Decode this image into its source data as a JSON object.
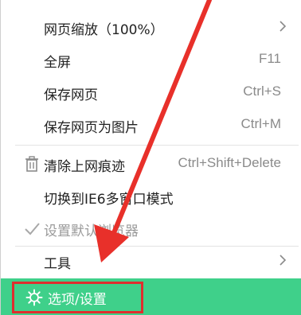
{
  "menu": {
    "items": [
      {
        "label": "网页缩放（100%）",
        "shortcut": "",
        "submenu": true
      },
      {
        "label": "全屏",
        "shortcut": "F11"
      },
      {
        "label": "保存网页",
        "shortcut": "Ctrl+S"
      },
      {
        "label": "保存网页为图片",
        "shortcut": "Ctrl+M"
      },
      {
        "label": "清除上网痕迹",
        "shortcut": "Ctrl+Shift+Delete",
        "icon": "trash-icon"
      },
      {
        "label": "切换到IE6多窗口模式",
        "shortcut": ""
      },
      {
        "label": "设置默认浏览器",
        "shortcut": "",
        "icon": "checkmark-icon",
        "disabled": true
      },
      {
        "label": "工具",
        "shortcut": "",
        "submenu": true
      }
    ],
    "settings_label": "选项/设置",
    "settings_icon": "gear-icon"
  },
  "colors": {
    "accent": "#3fd08a",
    "highlight_border": "#e02e2e",
    "annotation_arrow": "#e8302a"
  }
}
